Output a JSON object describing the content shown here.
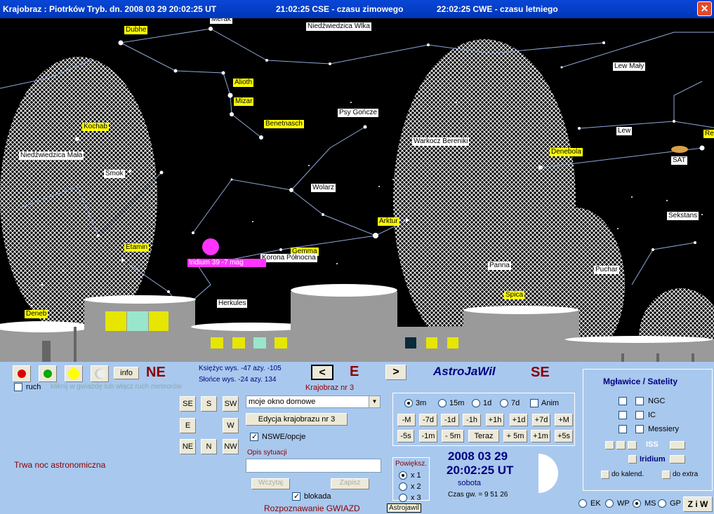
{
  "title": {
    "main": "Krajobraz : Piotrków Tryb.  dn.  2008 03 29    20:02:25 UT",
    "cse": "21:02:25 CSE - czasu zimowego",
    "cwe": "22:02:25 CWE - czasu letniego",
    "close": "✕"
  },
  "sky_labels": [
    {
      "text": "Dubhe",
      "style": "y"
    },
    {
      "text": "Merak",
      "style": "w"
    },
    {
      "text": "Niedźwiedzica Wlka",
      "style": "w"
    },
    {
      "text": "Lew Mały",
      "style": "w"
    },
    {
      "text": "Alioth",
      "style": "y"
    },
    {
      "text": "Mizar",
      "style": "y"
    },
    {
      "text": "Psy Gończe",
      "style": "w"
    },
    {
      "text": "Benetnasch",
      "style": "y"
    },
    {
      "text": "Kochab",
      "style": "y"
    },
    {
      "text": "Warkocz Bereniki",
      "style": "w"
    },
    {
      "text": "Lew",
      "style": "w"
    },
    {
      "text": "Re",
      "style": "y"
    },
    {
      "text": "Denebola",
      "style": "y"
    },
    {
      "text": "SAT",
      "style": "w"
    },
    {
      "text": "Niedźwiedzica Mała",
      "style": "w"
    },
    {
      "text": "Smok",
      "style": "w"
    },
    {
      "text": "Wolarz",
      "style": "w"
    },
    {
      "text": "Sekstans",
      "style": "w"
    },
    {
      "text": "Arktur",
      "style": "y"
    },
    {
      "text": "Etamin",
      "style": "y"
    },
    {
      "text": "Gemma",
      "style": "y"
    },
    {
      "text": "Korona Północna",
      "style": "w"
    },
    {
      "text": "Panna",
      "style": "w"
    },
    {
      "text": "Puchar",
      "style": "w"
    },
    {
      "text": "Spica",
      "style": "y"
    },
    {
      "text": "Herkules",
      "style": "w"
    },
    {
      "text": "Deneb",
      "style": "y"
    },
    {
      "text": "Iridium 39     -7 mag",
      "style": "m"
    }
  ],
  "panel": {
    "info": "info",
    "dir_left": "NE",
    "dir_center": "E",
    "dir_right": "SE",
    "prev": "<",
    "next": ">",
    "app": "AstroJaWil",
    "ruch": "ruch",
    "hint": "kliknij w gwiazdę lub włącz ruch meteorów",
    "moon": "Księżyc wys. -47   azy. -105",
    "sun": "Słońce wys. -24   azy. 134",
    "krajobraz_nr": "Krajobraz nr 3",
    "status": "Trwa noc astronomiczna",
    "dirs": [
      "SE",
      "S",
      "SW",
      "E",
      "W",
      "NE",
      "N",
      "NW"
    ],
    "select_value": "moje okno domowe",
    "edit_btn": "Edycja krajobrazu nr 3",
    "nswe": "NSWE/opcje",
    "opis": "Opis sytuacji",
    "wczytaj": "Wczytaj",
    "zapisz": "Zapisz",
    "blokada": "blokada",
    "rozpoznawanie": "Rozpoznawanie GWIAZD",
    "steps": [
      "3m",
      "15m",
      "1d",
      "7d"
    ],
    "anim": "Anim",
    "row1": [
      "-M",
      "-7d",
      "-1d",
      "-1h",
      "+1h",
      "+1d",
      "+7d",
      "+M"
    ],
    "row2": [
      "-5s",
      "-1m",
      "- 5m",
      "Teraz",
      "+ 5m",
      "+1m",
      "+5s"
    ],
    "powieksz": "Powiększ.",
    "zoom": [
      "x 1",
      "x 2",
      "x 3"
    ],
    "date": "2008 03 29",
    "time": "20:02:25 UT",
    "weekday": "sobota",
    "czas_gw": "Czas gw. =     9 51 26",
    "tooltip": "Astrojawil",
    "mgl_title": "Mgławice / Satelity",
    "ngc": "NGC",
    "ic": "IC",
    "messiery": "Messiery",
    "iss": "ISS",
    "iridium": "Iridium",
    "do_kalend": "do kalend.",
    "do_extra": "do extra",
    "modes": [
      "EK",
      "WP",
      "MS",
      "GP"
    ],
    "ziw": "Z i W"
  },
  "colors": {
    "sky": "#000000",
    "panel": "#a9c8ee",
    "label_yellow": "#ffff00",
    "label_magenta": "#ff33ff",
    "title_blue": "#0a46d6",
    "accent_red": "#8b0000",
    "navy": "#000080"
  }
}
